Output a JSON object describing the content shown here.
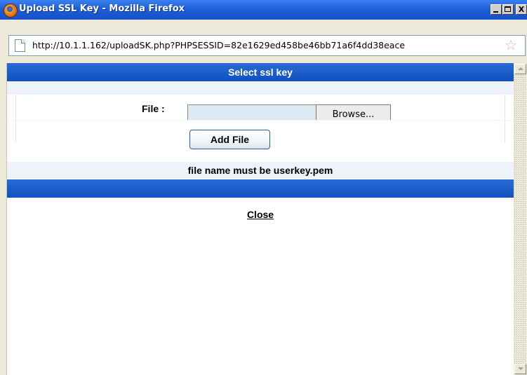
{
  "window": {
    "title": "Upload SSL Key - Mozilla Firefox",
    "controls": {
      "minimize": "_",
      "maximize": "□",
      "close": "X"
    }
  },
  "address_bar": {
    "url": "http://10.1.1.162/uploadSK.php?PHPSESSID=82e1629ed458be46bb71a6f4dd38eace",
    "page_icon": "page-icon",
    "bookmark_icon": "star-icon"
  },
  "content": {
    "header": "Select ssl key",
    "file_label": "File :",
    "file_input_value": "",
    "browse_label": "Browse...",
    "add_file_label": "Add File",
    "note": "file name must be userkey.pem",
    "close_link": "Close"
  },
  "colors": {
    "titlebar": "#1f5fd8",
    "header_bar": "#1150c0",
    "row_tint": "#eef3fa",
    "file_input_bg": "#dde9f0"
  }
}
